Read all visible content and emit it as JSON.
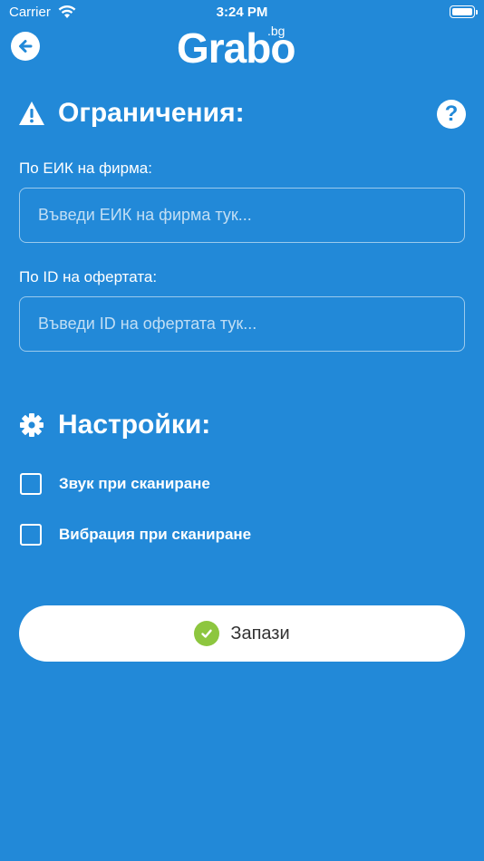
{
  "status_bar": {
    "carrier": "Carrier",
    "time": "3:24 PM"
  },
  "header": {
    "logo_text": "Grabo",
    "logo_suffix": ".bg"
  },
  "restrictions": {
    "title": "Ограничения:",
    "eik_label": "По ЕИК на фирма:",
    "eik_placeholder": "Въведи ЕИК на фирма тук...",
    "eik_value": "",
    "offer_label": "По ID на офертата:",
    "offer_placeholder": "Въведи ID на офертата тук...",
    "offer_value": ""
  },
  "settings": {
    "title": "Настройки:",
    "options": [
      {
        "label": "Звук при сканиране",
        "checked": false
      },
      {
        "label": "Вибрация при сканиране",
        "checked": false
      }
    ]
  },
  "save_button": {
    "label": "Запази"
  },
  "help_icon_glyph": "?",
  "colors": {
    "background": "#2289d8",
    "accent_check": "#8dc63f"
  }
}
